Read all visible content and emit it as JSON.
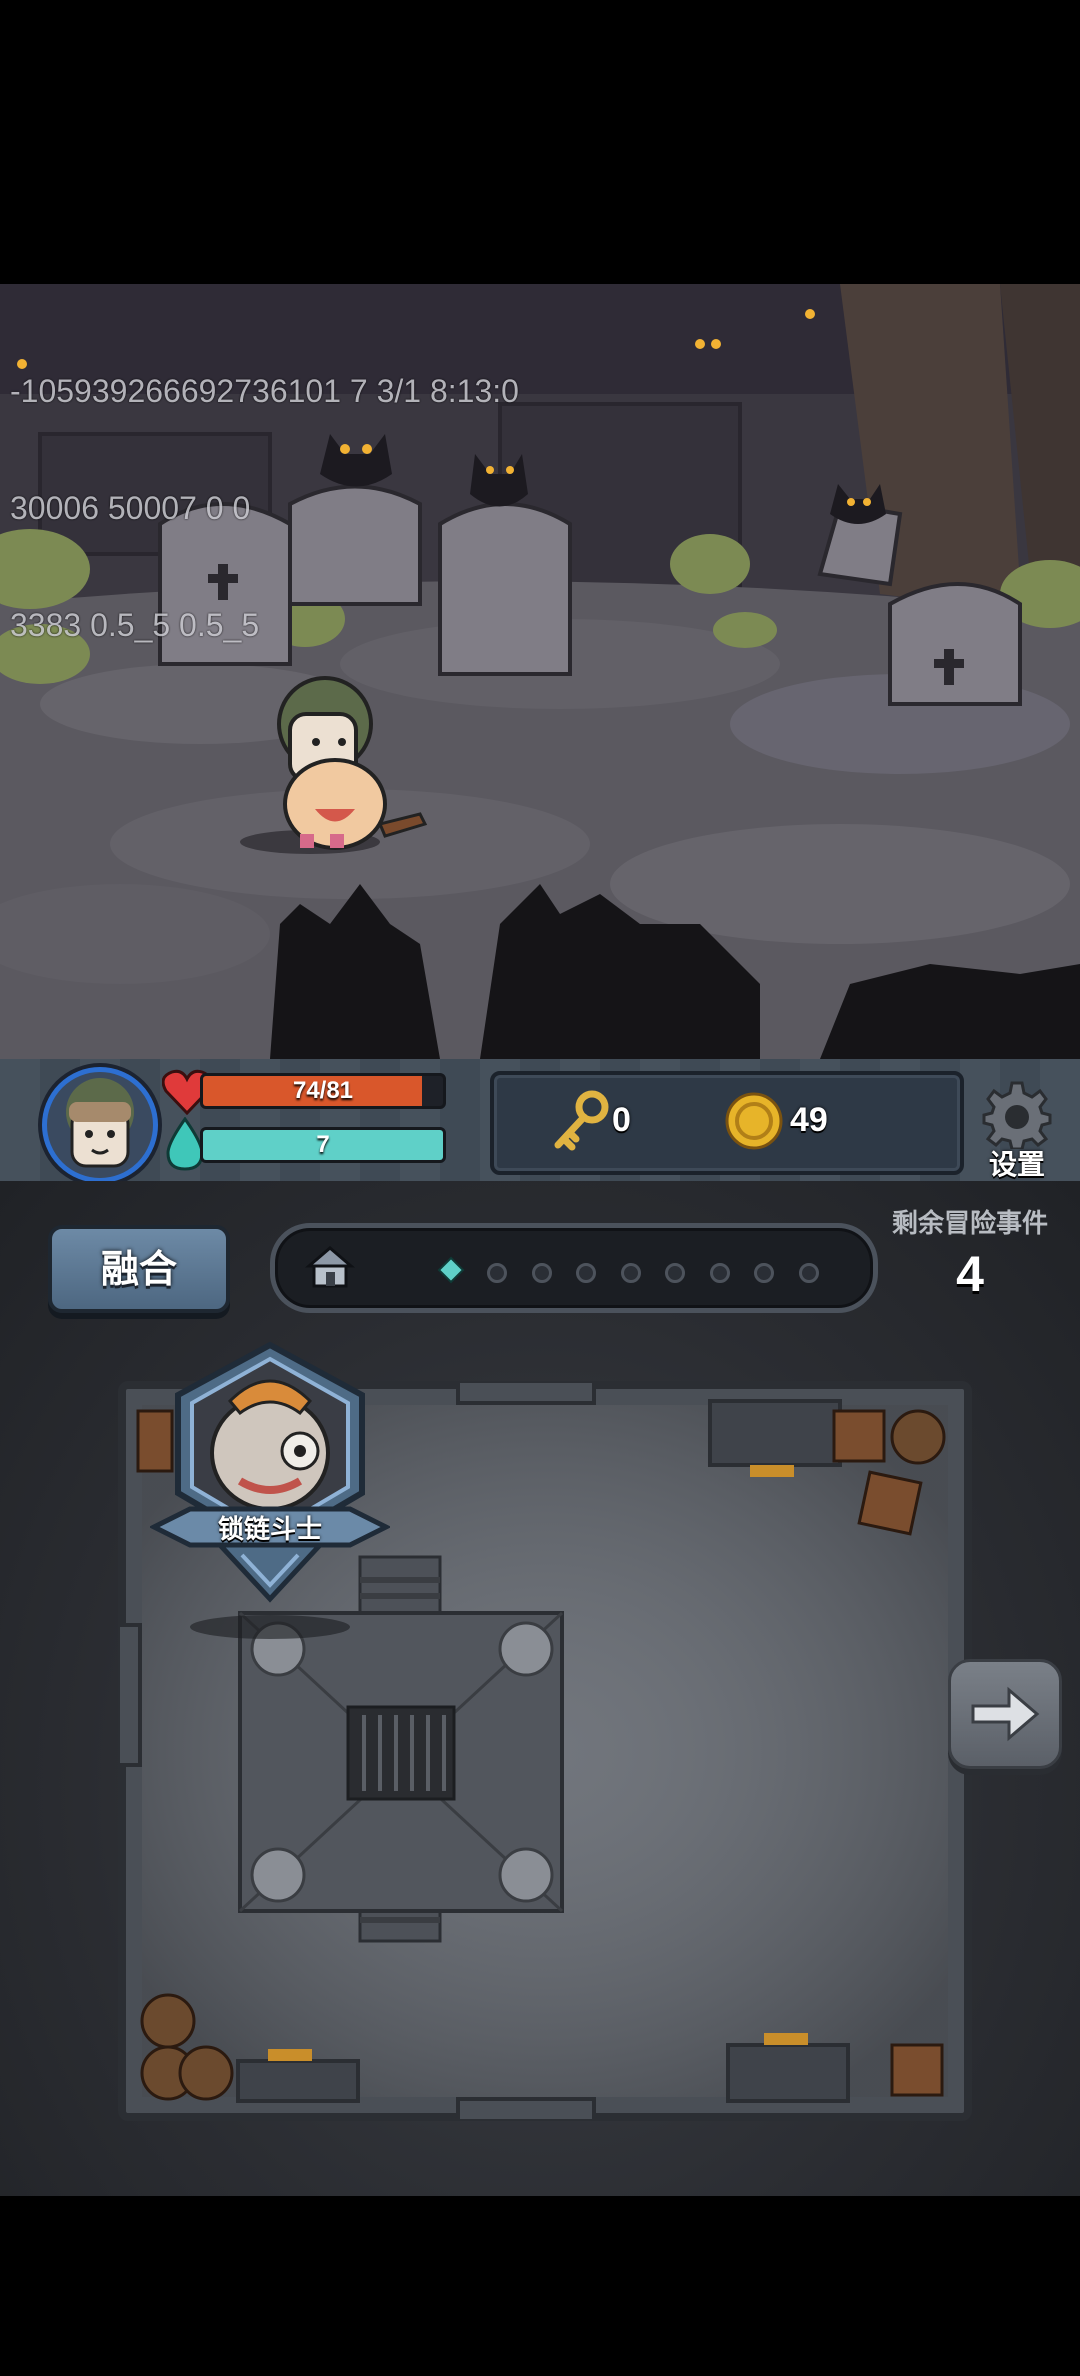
{
  "debug_overlay": {
    "lines": [
      "-105939266692736101 7 3/1 8:13:0",
      "30006 50007 0 0",
      "3383 0.5_5 0.5_5"
    ]
  },
  "hud": {
    "hp": {
      "current": 74,
      "max": 81,
      "label": "74/81",
      "color": "#d9572b"
    },
    "mana": {
      "value": 7,
      "label": "7",
      "fill_fraction": 1.0,
      "color": "#5fd0c8"
    },
    "keys": {
      "icon": "key-icon",
      "count": "0"
    },
    "gold": {
      "icon": "gold-coin-icon",
      "count": "49"
    },
    "settings": {
      "icon": "gear-icon",
      "label": "设置"
    }
  },
  "lower": {
    "merge_button": "融合",
    "progress": {
      "start_icon": "house-icon",
      "current_marker": "diamond-icon",
      "remaining_dots": 8
    },
    "events_label": "剩余冒险事件",
    "events_count": "4",
    "hero": {
      "name": "锁链斗士",
      "portrait": "chain-fighter-portrait"
    },
    "next_button_icon": "arrow-right-icon"
  }
}
